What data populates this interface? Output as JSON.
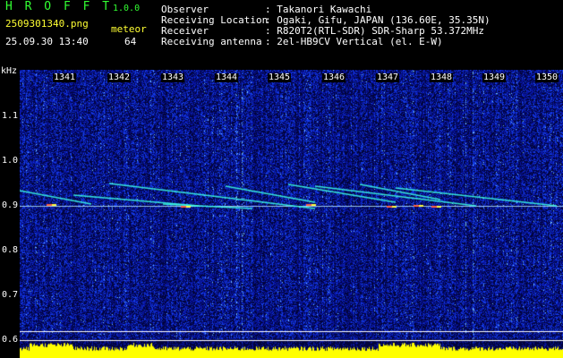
{
  "app": {
    "title": "H R O F F T",
    "version": "1.0.0",
    "filename": "2509301340.png",
    "datetime": "25.09.30 13:40",
    "meteor_label": "meteor",
    "meteor_count": "64"
  },
  "info": {
    "labels": [
      "Observer",
      "Receiving Location",
      "Receiver",
      "Receiving antenna"
    ],
    "values": [
      ": Takanori Kawachi",
      ": Ogaki, Gifu, JAPAN (136.60E, 35.35N)",
      ": R820T2(RTL-SDR) SDR-Sharp 53.372MHz",
      ": 2el-HB9CV Vertical (el. E-W)"
    ]
  },
  "axis": {
    "unit": "kHz",
    "y_ticks": [
      "1.1",
      "1.0",
      "0.9",
      "0.8",
      "0.7",
      "0.6"
    ],
    "x_ticks": [
      "1341",
      "1342",
      "1343",
      "1344",
      "1345",
      "1346",
      "1347",
      "1348",
      "1349",
      "1350"
    ]
  },
  "colors": {
    "background": "#000000",
    "title": "#32ff32",
    "info": "#ffff33",
    "noise": "#0a1aa0",
    "trace": "#33ffee",
    "bar": "#ffff00"
  }
}
